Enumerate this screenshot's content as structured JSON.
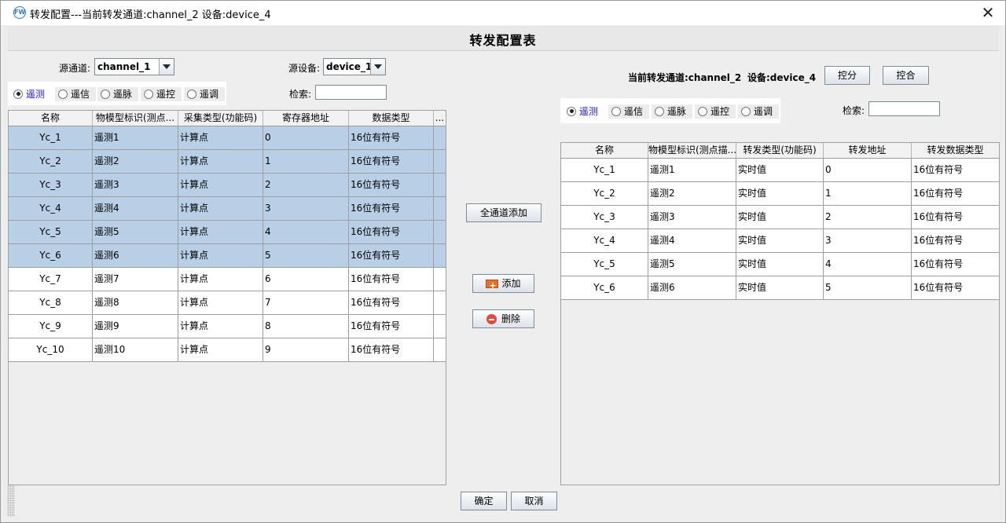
{
  "window": {
    "title": "转发配置---当前转发通道:channel_2  设备:device_4",
    "app_icon_label": "FW"
  },
  "header": {
    "title": "转发配置表"
  },
  "source": {
    "channel_label": "源通道:",
    "channel_value": "channel_1",
    "device_label": "源设备:",
    "device_value": "device_1",
    "search_label": "检索:",
    "search_value": "",
    "radios": [
      {
        "label": "遥测",
        "selected": true
      },
      {
        "label": "遥信",
        "selected": false
      },
      {
        "label": "遥脉",
        "selected": false
      },
      {
        "label": "遥控",
        "selected": false
      },
      {
        "label": "遥调",
        "selected": false
      }
    ],
    "table": {
      "columns": [
        "名称",
        "物模型标识(测点...",
        "采集类型(功能码)",
        "寄存器地址",
        "数据类型",
        "..."
      ],
      "rows": [
        {
          "name": "Yc_1",
          "model": "遥测1",
          "type": "计算点",
          "addr": "0",
          "dtype": "16位有符号",
          "selected": true
        },
        {
          "name": "Yc_2",
          "model": "遥测2",
          "type": "计算点",
          "addr": "1",
          "dtype": "16位有符号",
          "selected": true
        },
        {
          "name": "Yc_3",
          "model": "遥测3",
          "type": "计算点",
          "addr": "2",
          "dtype": "16位有符号",
          "selected": true
        },
        {
          "name": "Yc_4",
          "model": "遥测4",
          "type": "计算点",
          "addr": "3",
          "dtype": "16位有符号",
          "selected": true
        },
        {
          "name": "Yc_5",
          "model": "遥测5",
          "type": "计算点",
          "addr": "4",
          "dtype": "16位有符号",
          "selected": true
        },
        {
          "name": "Yc_6",
          "model": "遥测6",
          "type": "计算点",
          "addr": "5",
          "dtype": "16位有符号",
          "selected": true
        },
        {
          "name": "Yc_7",
          "model": "遥测7",
          "type": "计算点",
          "addr": "6",
          "dtype": "16位有符号",
          "selected": false
        },
        {
          "name": "Yc_8",
          "model": "遥测8",
          "type": "计算点",
          "addr": "7",
          "dtype": "16位有符号",
          "selected": false
        },
        {
          "name": "Yc_9",
          "model": "遥测9",
          "type": "计算点",
          "addr": "8",
          "dtype": "16位有符号",
          "selected": false
        },
        {
          "name": "Yc_10",
          "model": "遥测10",
          "type": "计算点",
          "addr": "9",
          "dtype": "16位有符号",
          "selected": false
        }
      ]
    }
  },
  "middle": {
    "add_all_label": "全通道添加",
    "add_label": "添加",
    "delete_label": "删除"
  },
  "target": {
    "current_channel_label": "当前转发通道:channel_2",
    "current_device_label": "设备:device_4",
    "control_split_label": "控分",
    "control_close_label": "控合",
    "search_label": "检索:",
    "search_value": "",
    "radios": [
      {
        "label": "遥测",
        "selected": true
      },
      {
        "label": "遥信",
        "selected": false
      },
      {
        "label": "遥脉",
        "selected": false
      },
      {
        "label": "遥控",
        "selected": false
      },
      {
        "label": "遥调",
        "selected": false
      }
    ],
    "table": {
      "columns": [
        "名称",
        "物模型标识(测点描...",
        "转发类型(功能码)",
        "转发地址",
        "转发数据类型"
      ],
      "rows": [
        {
          "name": "Yc_1",
          "model": "遥测1",
          "type": "实时值",
          "addr": "0",
          "dtype": "16位有符号"
        },
        {
          "name": "Yc_2",
          "model": "遥测2",
          "type": "实时值",
          "addr": "1",
          "dtype": "16位有符号"
        },
        {
          "name": "Yc_3",
          "model": "遥测3",
          "type": "实时值",
          "addr": "2",
          "dtype": "16位有符号"
        },
        {
          "name": "Yc_4",
          "model": "遥测4",
          "type": "实时值",
          "addr": "3",
          "dtype": "16位有符号"
        },
        {
          "name": "Yc_5",
          "model": "遥测5",
          "type": "实时值",
          "addr": "4",
          "dtype": "16位有符号"
        },
        {
          "name": "Yc_6",
          "model": "遥测6",
          "type": "实时值",
          "addr": "5",
          "dtype": "16位有符号"
        }
      ]
    }
  },
  "footer": {
    "ok_label": "确定",
    "cancel_label": "取消"
  }
}
